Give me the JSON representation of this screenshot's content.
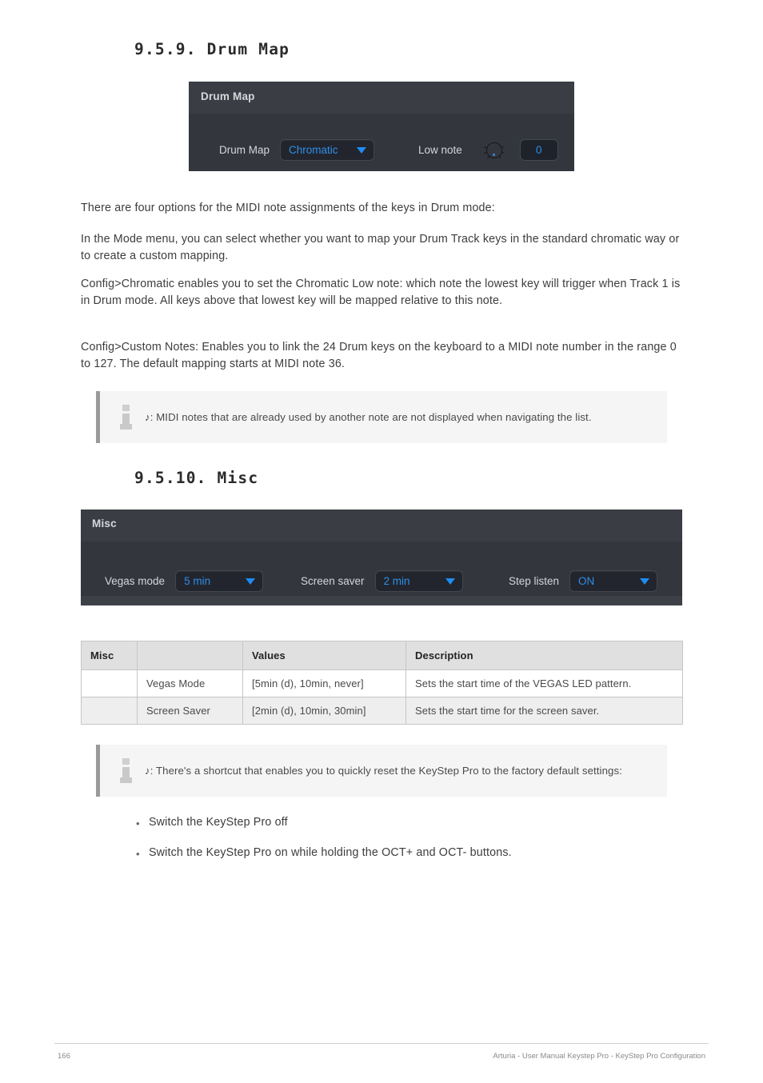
{
  "sections": {
    "drum_map": {
      "heading": "9.5.9. Drum Map",
      "panel": {
        "title": "Drum Map",
        "drum_map_label": "Drum Map",
        "drum_map_value": "Chromatic",
        "low_note_label": "Low note",
        "low_note_value": "0"
      },
      "paragraphs": [
        "There are four options for the MIDI note assignments of the keys in Drum mode:",
        "In the Mode menu, you can select whether you want to map your Drum Track keys in the standard chromatic way or to create a custom mapping.",
        "Config>Chromatic enables you to set the Chromatic Low note: which note the lowest key will trigger when Track 1 is in Drum mode. All keys above that lowest key will be mapped relative to this note.",
        "Config>Custom Notes: Enables you to link the 24 Drum keys on the keyboard to a MIDI note number in the range 0 to 127. The default mapping starts at MIDI note 36."
      ],
      "note": "♪: MIDI notes that are already used by another note are not displayed when navigating the list."
    },
    "misc": {
      "heading": "9.5.10. Misc",
      "panel": {
        "title": "Misc",
        "controls": [
          {
            "label": "Vegas mode",
            "value": "5 min"
          },
          {
            "label": "Screen saver",
            "value": "2 min"
          },
          {
            "label": "Step listen",
            "value": "ON"
          }
        ]
      },
      "table": {
        "headers": [
          "Misc",
          "",
          "Values",
          "Description"
        ],
        "rows": [
          [
            "",
            "Vegas Mode",
            "[5min (d), 10min, never]",
            "Sets the start time of the VEGAS LED pattern."
          ],
          [
            "",
            "Screen Saver",
            "[2min (d), 10min, 30min]",
            "Sets the start time for the screen saver."
          ]
        ]
      },
      "note": "♪: There's a shortcut that enables you to quickly reset the KeyStep Pro to the factory default settings:",
      "bullets": [
        "Switch the KeyStep Pro off",
        "Switch the KeyStep Pro on while holding the OCT+ and OCT- buttons."
      ],
      "bullet_marker": "•"
    }
  },
  "footer": {
    "page_number": "166",
    "manual_title": "Arturia - User Manual Keystep Pro - KeyStep Pro Configuration"
  },
  "colors": {
    "accent_blue": "#2f8fe8",
    "panel_dark": "#33363c",
    "panel_head": "#3a3d44"
  }
}
